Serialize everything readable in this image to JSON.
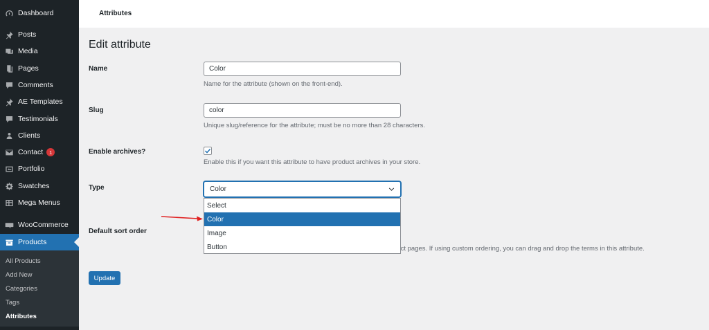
{
  "sidebar": {
    "items": [
      {
        "label": "Dashboard",
        "icon": "dashboard-icon"
      },
      {
        "label": "Posts",
        "icon": "pin-icon"
      },
      {
        "label": "Media",
        "icon": "media-icon"
      },
      {
        "label": "Pages",
        "icon": "pages-icon"
      },
      {
        "label": "Comments",
        "icon": "comments-icon"
      },
      {
        "label": "AE Templates",
        "icon": "pin-icon"
      },
      {
        "label": "Testimonials",
        "icon": "testimonials-icon"
      },
      {
        "label": "Clients",
        "icon": "clients-icon"
      },
      {
        "label": "Contact",
        "icon": "mail-icon",
        "badge": "1"
      },
      {
        "label": "Portfolio",
        "icon": "portfolio-icon"
      },
      {
        "label": "Swatches",
        "icon": "gear-icon"
      },
      {
        "label": "Mega Menus",
        "icon": "grid-icon"
      },
      {
        "label": "WooCommerce",
        "icon": "woocommerce-icon"
      },
      {
        "label": "Products",
        "icon": "products-icon",
        "active": true
      }
    ],
    "submenu": [
      "All Products",
      "Add New",
      "Categories",
      "Tags",
      "Attributes"
    ]
  },
  "header": {
    "title": "Attributes"
  },
  "main": {
    "page_title": "Edit attribute",
    "name": {
      "label": "Name",
      "value": "Color",
      "desc": "Name for the attribute (shown on the front-end)."
    },
    "slug": {
      "label": "Slug",
      "value": "color",
      "desc": "Unique slug/reference for the attribute; must be no more than 28 characters."
    },
    "archives": {
      "label": "Enable archives?",
      "checked": true,
      "desc": "Enable this if you want this attribute to have product archives in your store."
    },
    "type": {
      "label": "Type",
      "selected": "Color",
      "options": [
        "Select",
        "Color",
        "Image",
        "Button"
      ]
    },
    "sort": {
      "label": "Default sort order",
      "desc_visible": "duct pages. If using custom ordering, you can drag and drop the terms in this attribute."
    },
    "update_label": "Update"
  },
  "colors": {
    "sidebar_bg": "#1d2327",
    "accent": "#2271b1",
    "badge": "#d63638",
    "annotation_arrow": "#e02020"
  }
}
